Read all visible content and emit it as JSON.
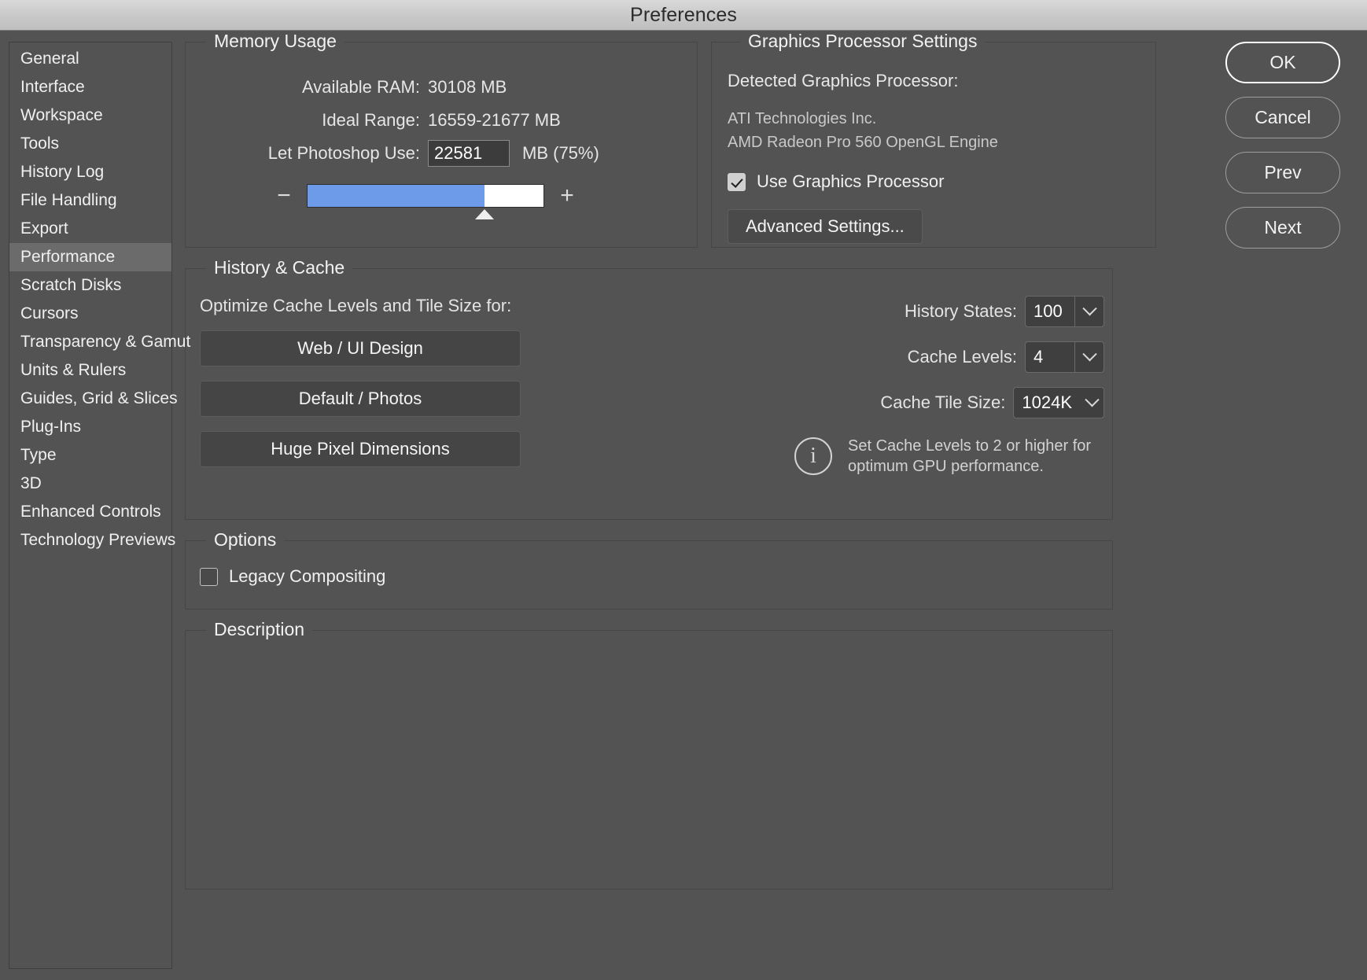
{
  "window": {
    "title": "Preferences"
  },
  "sidebar": {
    "items": [
      {
        "label": "General",
        "selected": false
      },
      {
        "label": "Interface",
        "selected": false
      },
      {
        "label": "Workspace",
        "selected": false
      },
      {
        "label": "Tools",
        "selected": false
      },
      {
        "label": "History Log",
        "selected": false
      },
      {
        "label": "File Handling",
        "selected": false
      },
      {
        "label": "Export",
        "selected": false
      },
      {
        "label": "Performance",
        "selected": true
      },
      {
        "label": "Scratch Disks",
        "selected": false
      },
      {
        "label": "Cursors",
        "selected": false
      },
      {
        "label": "Transparency & Gamut",
        "selected": false
      },
      {
        "label": "Units & Rulers",
        "selected": false
      },
      {
        "label": "Guides, Grid & Slices",
        "selected": false
      },
      {
        "label": "Plug-Ins",
        "selected": false
      },
      {
        "label": "Type",
        "selected": false
      },
      {
        "label": "3D",
        "selected": false
      },
      {
        "label": "Enhanced Controls",
        "selected": false
      },
      {
        "label": "Technology Previews",
        "selected": false
      }
    ]
  },
  "memory_usage": {
    "legend": "Memory Usage",
    "available_ram_label": "Available RAM:",
    "available_ram_value": "30108 MB",
    "ideal_range_label": "Ideal Range:",
    "ideal_range_value": "16559-21677 MB",
    "let_use_label": "Let Photoshop Use:",
    "let_use_value": "22581",
    "let_use_suffix": "MB (75%)",
    "slider_percent": 75,
    "slider_minus": "−",
    "slider_plus": "+",
    "fill_color": "#6d9bea"
  },
  "graphics_processor": {
    "legend": "Graphics Processor Settings",
    "detected_label": "Detected Graphics Processor:",
    "vendor": "ATI Technologies Inc.",
    "renderer": "AMD Radeon Pro 560 OpenGL Engine",
    "use_gpu_label": "Use Graphics Processor",
    "use_gpu_checked": true,
    "advanced_button": "Advanced Settings..."
  },
  "history_cache": {
    "legend": "History & Cache",
    "optimize_label": "Optimize Cache Levels and Tile Size for:",
    "presets": [
      {
        "label": "Web / UI Design"
      },
      {
        "label": "Default / Photos"
      },
      {
        "label": "Huge Pixel Dimensions"
      }
    ],
    "fields": [
      {
        "label": "History States:",
        "value": "100",
        "style": "split"
      },
      {
        "label": "Cache Levels:",
        "value": "4",
        "style": "split"
      },
      {
        "label": "Cache Tile Size:",
        "value": "1024K",
        "style": "unified"
      }
    ],
    "hint_line1": "Set Cache Levels to 2 or higher for",
    "hint_line2": "optimum GPU performance."
  },
  "options": {
    "legend": "Options",
    "legacy_compositing_label": "Legacy Compositing",
    "legacy_compositing_checked": false
  },
  "description": {
    "legend": "Description",
    "text": ""
  },
  "actions": {
    "ok": "OK",
    "cancel": "Cancel",
    "prev": "Prev",
    "next": "Next"
  }
}
